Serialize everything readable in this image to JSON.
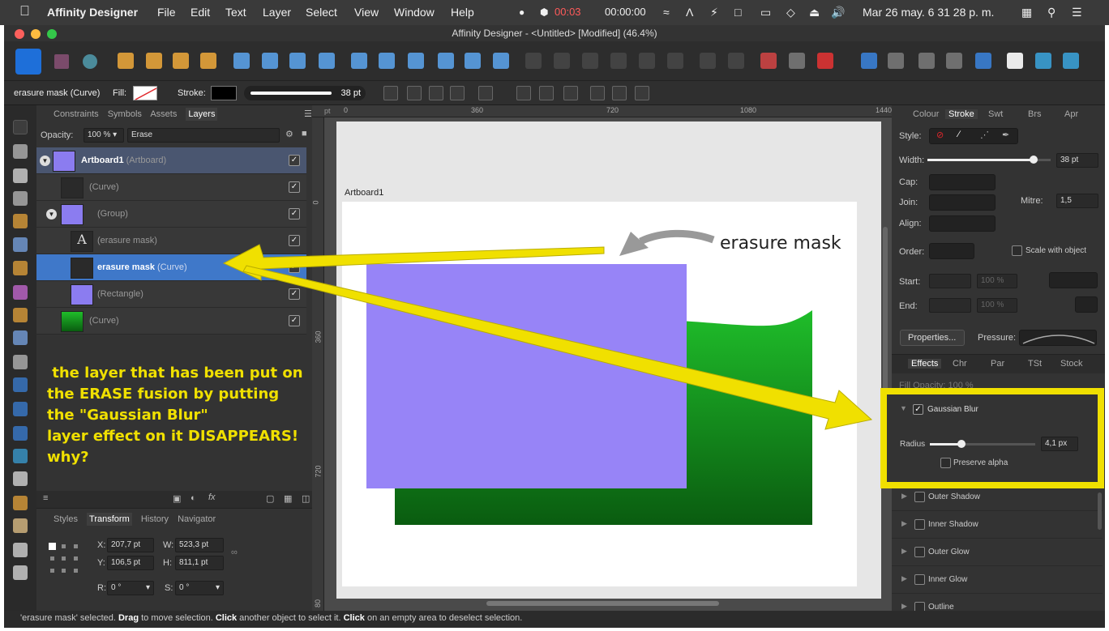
{
  "menubar": {
    "app": "Affinity Designer",
    "items": [
      "File",
      "Edit",
      "Text",
      "Layer",
      "Select",
      "View",
      "Window",
      "Help"
    ],
    "rec_time": "00:03",
    "timer": "00:00:00",
    "clock": "Mar 26 may.  6 31 28 p. m."
  },
  "window": {
    "title": "Affinity Designer - <Untitled> [Modified] (46.4%)"
  },
  "context": {
    "selection": "erasure mask (Curve)",
    "fill_label": "Fill:",
    "stroke_label": "Stroke:",
    "stroke_width": "38 pt"
  },
  "layers_panel": {
    "tabs": [
      "Constraints",
      "Symbols",
      "Assets",
      "Layers"
    ],
    "opacity_label": "Opacity:",
    "opacity_value": "100 %",
    "blend_mode": "Erase",
    "rows": [
      {
        "name": "Artboard1",
        "type": "(Artboard)"
      },
      {
        "name": "",
        "type": "(Curve)"
      },
      {
        "name": "",
        "type": "(Group)"
      },
      {
        "name": "",
        "type": "(erasure mask)"
      },
      {
        "name": "erasure mask",
        "type": "(Curve)"
      },
      {
        "name": "",
        "type": "(Rectangle)"
      },
      {
        "name": "",
        "type": "(Curve)"
      }
    ]
  },
  "annotation": {
    "lines": [
      " the layer that has been put on",
      "the ERASE fusion by putting",
      "the \"Gaussian Blur\"",
      "layer effect on it DISAPPEARS!",
      "why?"
    ],
    "canvas_note": "erasure mask"
  },
  "transform_panel": {
    "tabs": [
      "Styles",
      "Transform",
      "History",
      "Navigator"
    ],
    "x_label": "X:",
    "x": "207,7 pt",
    "y_label": "Y:",
    "y": "106,5 pt",
    "w_label": "W:",
    "w": "523,3 pt",
    "h_label": "H:",
    "h": "811,1 pt",
    "r_label": "R:",
    "r": "0 °",
    "s_label": "S:",
    "s": "0 °"
  },
  "canvas": {
    "artboard_label": "Artboard1",
    "ruler_top": [
      "0",
      "360",
      "720",
      "1080",
      "1440"
    ],
    "ruler_left": [
      "0",
      "360",
      "720",
      "80"
    ],
    "ruler_unit": "pt"
  },
  "stroke_panel": {
    "tabs": [
      "Colour",
      "Stroke",
      "Swt",
      "Brs",
      "Apr"
    ],
    "style_label": "Style:",
    "width_label": "Width:",
    "width_value": "38 pt",
    "width_fraction": 0.86,
    "cap_label": "Cap:",
    "join_label": "Join:",
    "mitre_label": "Mitre:",
    "mitre_value": "1,5",
    "align_label": "Align:",
    "order_label": "Order:",
    "scale_label": "Scale with object",
    "start_label": "Start:",
    "end_label": "End:",
    "start_pct": "100 %",
    "end_pct": "100 %",
    "properties_label": "Properties...",
    "pressure_label": "Pressure:"
  },
  "effects_panel": {
    "tabs": [
      "Effects",
      "Chr",
      "Par",
      "TSt",
      "Stock"
    ],
    "fill_opacity": "Fill Opacity:  100 %",
    "gaussian_blur": "Gaussian Blur",
    "radius_label": "Radius",
    "radius_value": "4,1 px",
    "radius_fraction": 0.3,
    "preserve_alpha": "Preserve alpha",
    "effects": [
      "Outer Shadow",
      "Inner Shadow",
      "Outer Glow",
      "Inner Glow",
      "Outline"
    ]
  },
  "status": {
    "p1": "'erasure mask' selected. ",
    "b1": "Drag",
    "p2": " to move selection. ",
    "b2": "Click",
    "p3": " another object to select it. ",
    "b3": "Click",
    "p4": " on an empty area to deselect selection."
  },
  "colors": {
    "highlight": "#f0e000",
    "purple": "#9784f7",
    "green_top": "#1fbd2a",
    "green_bottom": "#0a5c10",
    "selected_row": "#3f78c9"
  }
}
